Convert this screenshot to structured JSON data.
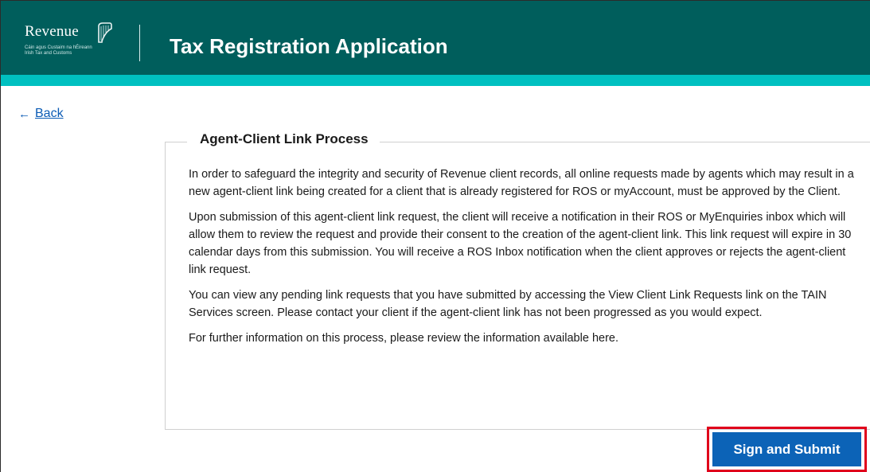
{
  "header": {
    "logo_word": "Revenue",
    "logo_sub_line1": "Cáin agus Custaim na hÉireann",
    "logo_sub_line2": "Irish Tax and Customs",
    "title": "Tax Registration Application"
  },
  "nav": {
    "back_arrow": "←",
    "back_label": "Back"
  },
  "panel": {
    "legend": "Agent-Client Link Process",
    "paragraphs": [
      "In order to safeguard the integrity and security of Revenue client records, all online requests made by agents which may result in a new agent-client link being created for a client that is already registered for ROS or myAccount, must be approved by the Client.",
      "Upon submission of this agent-client link request, the client will receive a notification in their ROS or MyEnquiries inbox which will allow them to review the request and provide their consent to the creation of the agent-client link. This link request will expire in 30 calendar days from this submission. You will receive a ROS Inbox notification when the client approves or rejects the agent-client link request.",
      "You can view any pending link requests that you have submitted by accessing the View Client Link Requests link on the TAIN Services screen. Please contact your client if the agent-client link has not been progressed as you would expect.",
      "For further information on this process, please review the information available here."
    ]
  },
  "actions": {
    "submit_label": "Sign and Submit"
  },
  "colors": {
    "header_bg": "#005e5c",
    "header_stripe": "#00c0c0",
    "link": "#0b5bb5",
    "button_bg": "#0c63b7",
    "highlight": "#e0001b"
  }
}
